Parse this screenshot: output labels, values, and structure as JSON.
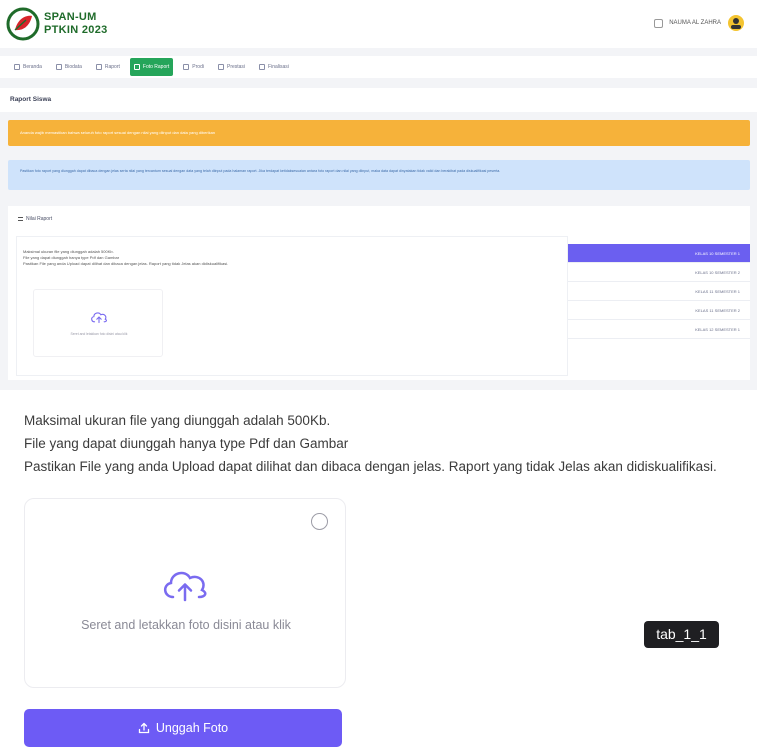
{
  "app": {
    "logo_line1": "SPAN-UM",
    "logo_line2": "PTKIN 2023",
    "user_name": "NAUMA AL ZAHRA"
  },
  "nav": {
    "items": [
      {
        "label": "Beranda",
        "icon": "home-icon"
      },
      {
        "label": "Biodata",
        "icon": "user-icon"
      },
      {
        "label": "Raport",
        "icon": "book-icon"
      },
      {
        "label": "Foto Raport",
        "icon": "image-icon",
        "active": true
      },
      {
        "label": "Prodi",
        "icon": "school-icon"
      },
      {
        "label": "Prestasi",
        "icon": "trophy-icon"
      },
      {
        "label": "Finalisasi",
        "icon": "check-icon"
      }
    ]
  },
  "page": {
    "title": "Raport Siswa",
    "alert_warning": "Ananda wajib memastikan bahwa seluruh foto raport sesuai dengan nilai yang diinput dan data yang diberikan",
    "alert_info": "Pastikan foto raport yang diunggah dapat dibaca dengan jelas serta nilai yang tercantum sesuai dengan data yang telah diinput pada halaman raport. Jika terdapat ketidaksesuaian antara foto raport dan nilai yang diinput, maka data dapat dinyatakan tidak valid dan berakibat pada diskualifikasi peserta.",
    "card_title": "Nilai Raport"
  },
  "mini_info": {
    "line1": "Maksimal ukuran file yang diunggah adalah 500Kb.",
    "line2": "File yang dapat diunggah hanya type Pdf dan Gambar",
    "line3": "Pastikan File yang anda Upload dapat dilihat dan dibaca dengan jelas. Raport yang tidak Jelas akan didiskualifikasi.",
    "drop_caption": "Seret and letakkan foto disini atau klik"
  },
  "semesters": [
    {
      "label": "KELAS 10 SEMESTER 1",
      "active": true
    },
    {
      "label": "KELAS 10 SEMESTER 2"
    },
    {
      "label": "KELAS 11 SEMESTER 1"
    },
    {
      "label": "KELAS 11 SEMESTER 2"
    },
    {
      "label": "KELAS 12 SEMESTER 1"
    }
  ],
  "upload": {
    "info_line1": "Maksimal ukuran file yang diunggah adalah 500Kb.",
    "info_line2": "File yang dapat diunggah hanya type Pdf dan Gambar",
    "info_line3": "Pastikan File yang anda Upload dapat dilihat dan dibaca dengan jelas. Raport yang tidak Jelas akan didiskualifikasi.",
    "drop_caption": "Seret and letakkan foto disini atau klik",
    "button_label": "Unggah Foto"
  },
  "overlay": {
    "tab_label": "tab_1_1"
  },
  "colors": {
    "primary": "#6d5bf5",
    "nav_active": "#25a55a",
    "warning": "#f6b23a",
    "info_bg": "#cfe3fb"
  }
}
